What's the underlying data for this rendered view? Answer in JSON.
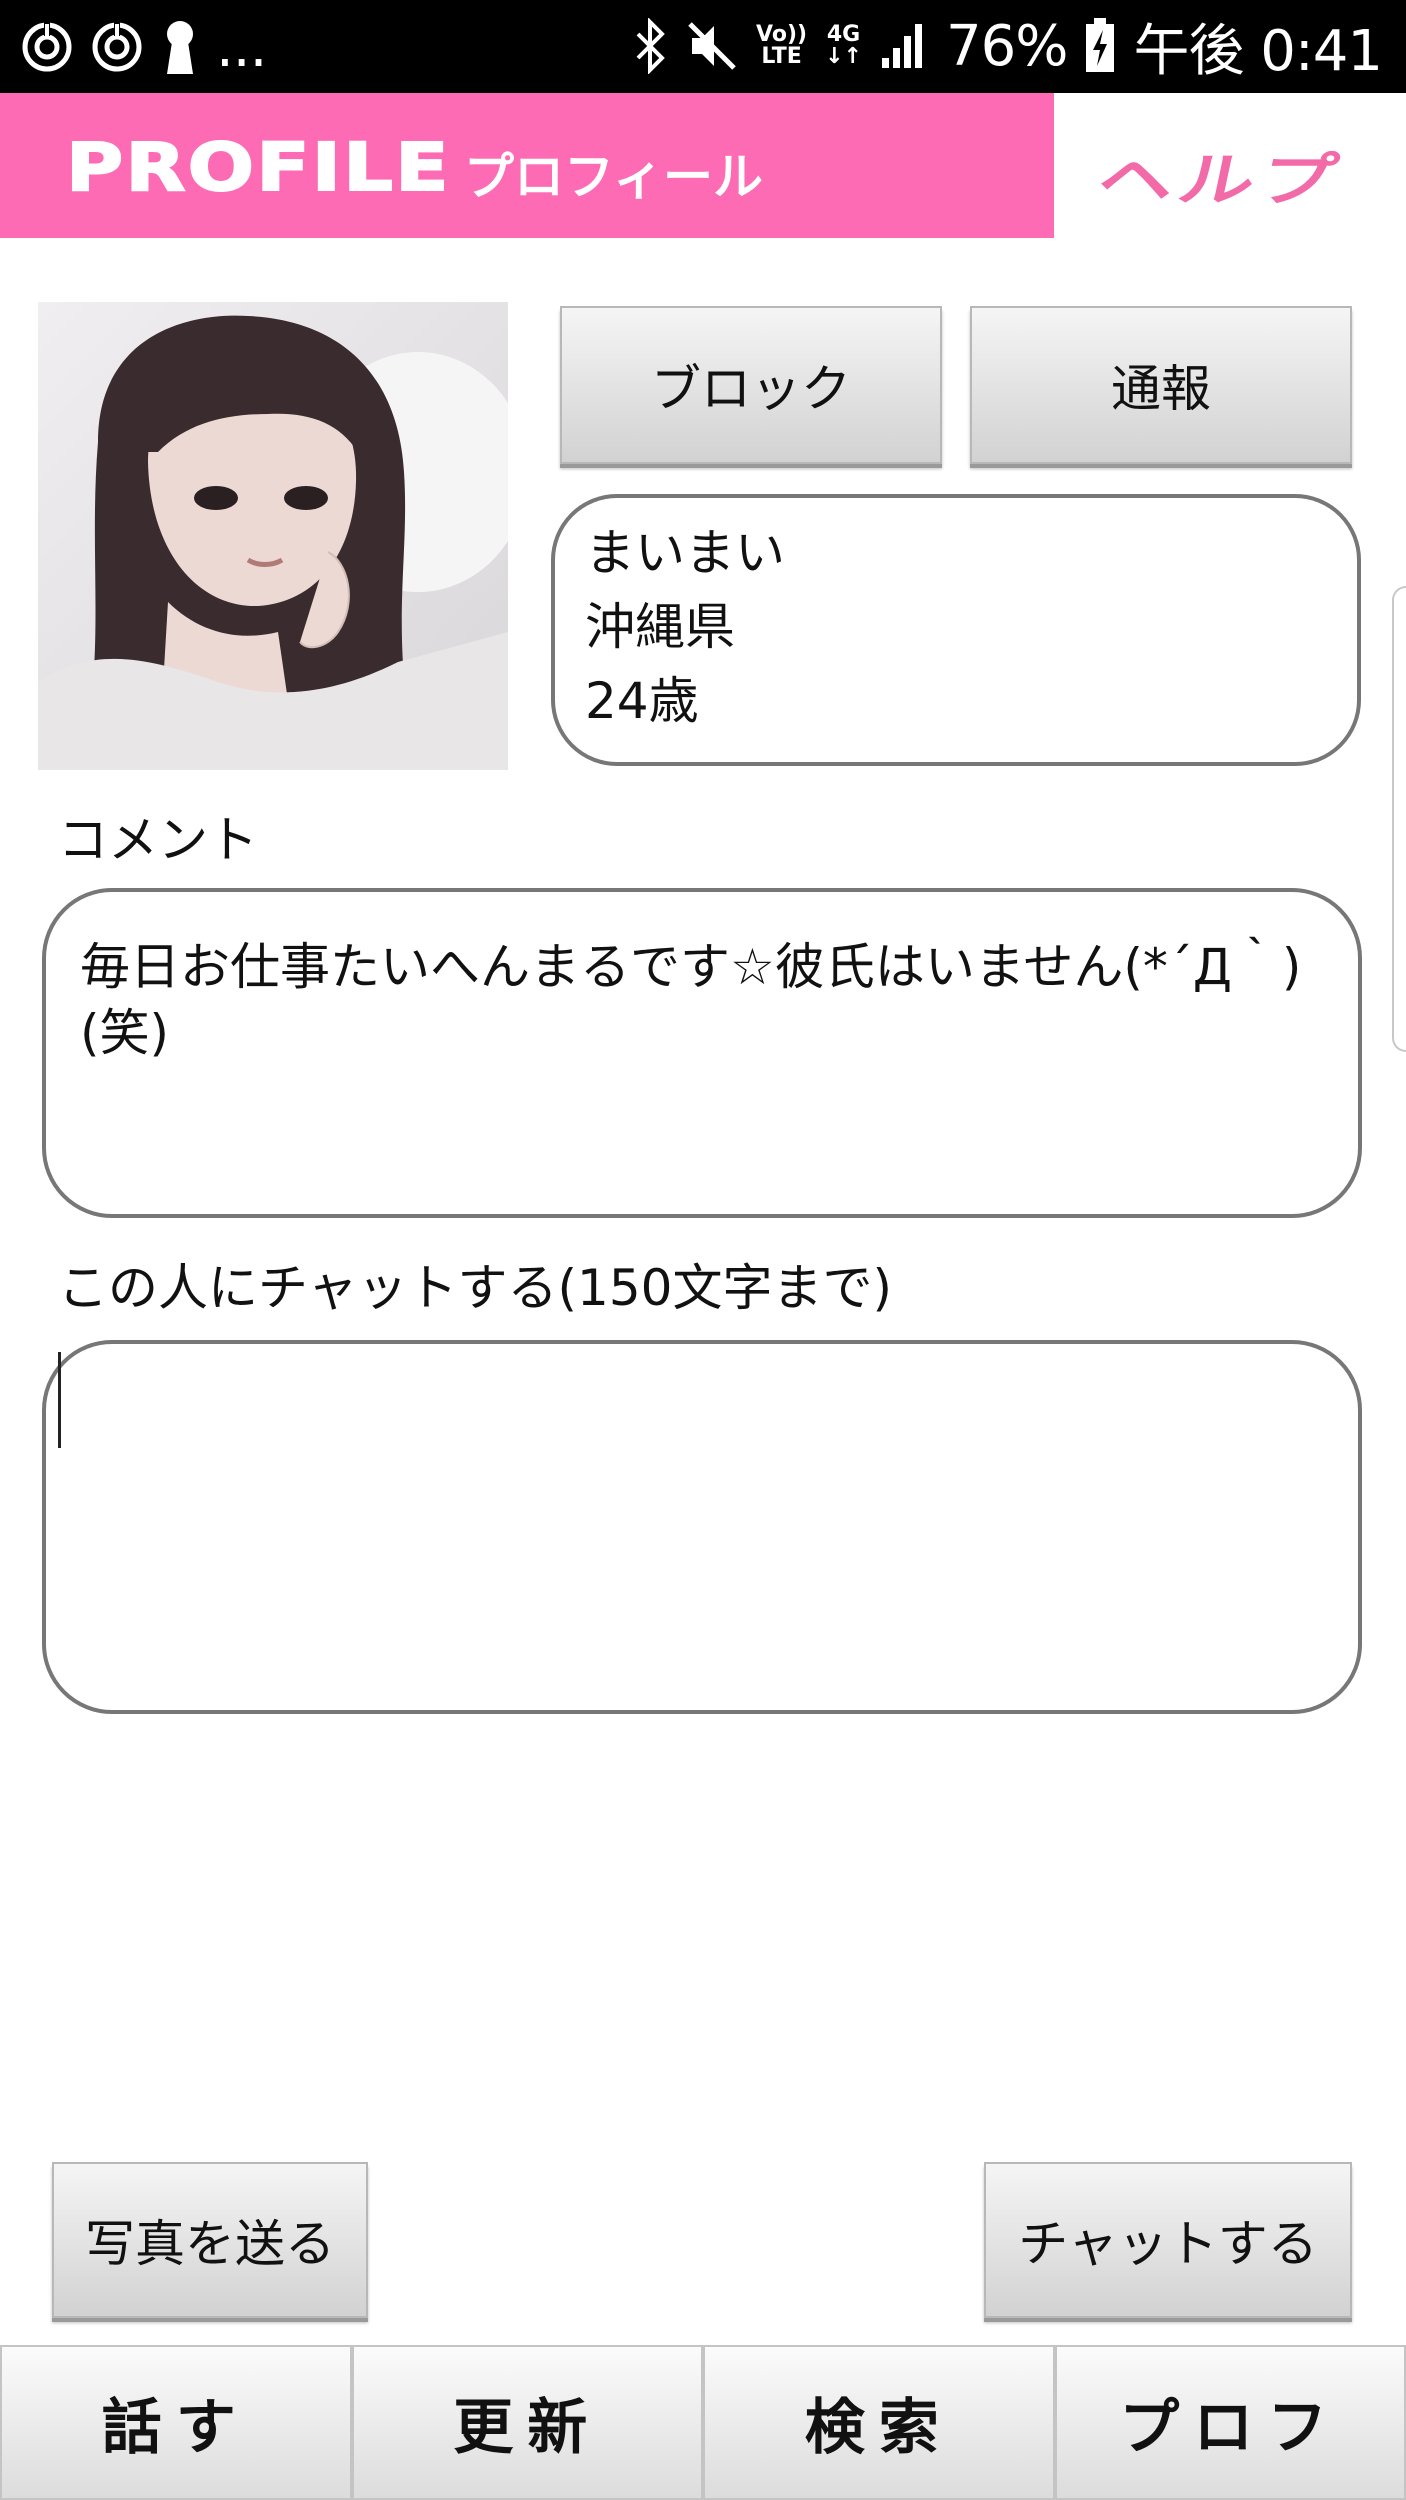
{
  "status_bar": {
    "left_icons": [
      "sync-icon",
      "sync-icon",
      "keyhole-icon",
      "more-icon"
    ],
    "more_text": "...",
    "volte_line1": "Vo))",
    "volte_line2": "LTE",
    "network_line1": "4G",
    "network_line2": "↓↑",
    "battery_percent": "76%",
    "time": "午後 0:41"
  },
  "header": {
    "logo_en": "PROFILE",
    "logo_jp": "プロフィール",
    "help_label": "ヘルプ",
    "accent_color": "#fc6bb3"
  },
  "profile": {
    "block_label": "ブロック",
    "report_label": "通報",
    "name": "まいまい",
    "prefecture": "沖縄県",
    "age": "24歳"
  },
  "comment": {
    "label": "コメント",
    "text": "毎日お仕事たいへんまるです☆彼氏はいません(*´Д｀)(笑)"
  },
  "chat": {
    "label": "この人にチャットする(150文字まで)",
    "value": ""
  },
  "actions": {
    "send_photo_label": "写真を送る",
    "chat_label": "チャットする"
  },
  "tabs": [
    {
      "label": "話す"
    },
    {
      "label": "更新"
    },
    {
      "label": "検索"
    },
    {
      "label": "プロフ"
    }
  ]
}
